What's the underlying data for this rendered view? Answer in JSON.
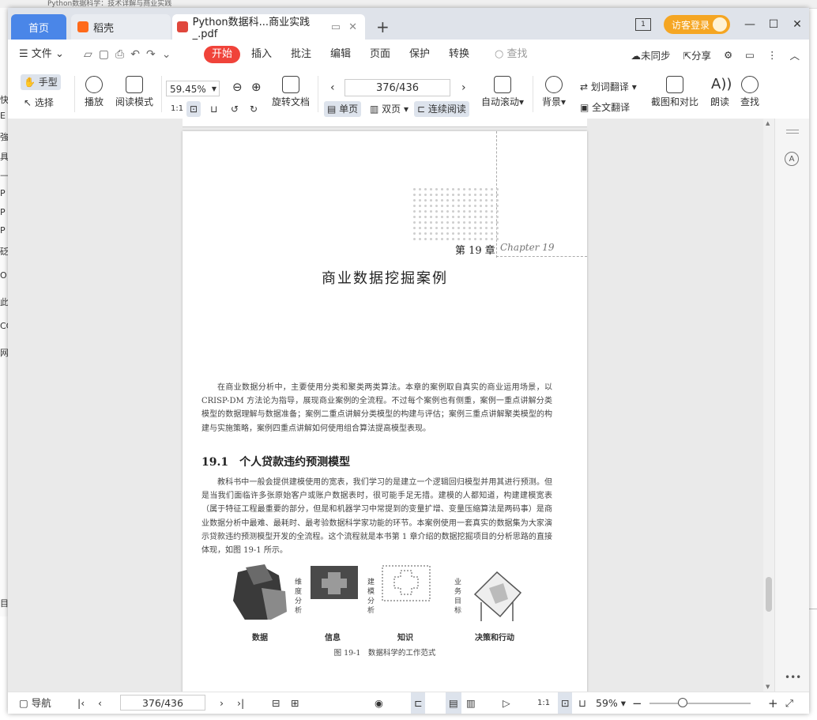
{
  "background_window": {
    "title": "Python数据科学：技术详解与商业实践"
  },
  "tabs": [
    {
      "label": "首页"
    },
    {
      "label": "稻壳"
    },
    {
      "label": "Python数据科...商业实践_.pdf"
    }
  ],
  "titlebar": {
    "guest_label": "访客登录"
  },
  "menu": {
    "file": "文件",
    "items": [
      "开始",
      "插入",
      "批注",
      "编辑",
      "页面",
      "保护",
      "转换"
    ],
    "search": "查找",
    "sync": "未同步",
    "share": "分享"
  },
  "toolbar": {
    "hand": "手型",
    "select": "选择",
    "play": "播放",
    "read_mode": "阅读模式",
    "zoom": "59.45%",
    "actual": "1:1",
    "rotate": "旋转文档",
    "page": "376/436",
    "single": "单页",
    "double": "双页",
    "continuous": "连续阅读",
    "autoscroll": "自动滚动",
    "background": "背景",
    "word_translate": "划词翻译",
    "full_translate": "全文翻译",
    "screenshot_compare": "截图和对比",
    "read_aloud": "朗读",
    "find": "查找"
  },
  "document": {
    "chapter_no": "第 19 章",
    "chapter_en": "Chapter 19",
    "chapter_title": "商业数据挖掘案例",
    "intro": "在商业数据分析中，主要使用分类和聚类两类算法。本章的案例取自真实的商业运用场景，以 CRISP-DM 方法论为指导，展现商业案例的全流程。不过每个案例也有侧重，案例一重点讲解分类模型的数据理解与数据准备；案例二重点讲解分类模型的构建与评估；案例三重点讲解聚类模型的构建与实施策略，案例四重点讲解如何使用组合算法提高模型表现。",
    "section": "19.1　个人贷款违约预测模型",
    "body": "教科书中一般会提供建模使用的宽表，我们学习的是建立一个逻辑回归模型并用其进行预测。但是当我们面临许多张原始客户或账户数据表时，很可能手足无措。建模的人都知道，构建建模宽表（属于特征工程最重要的部分，但是和机器学习中常提到的变量扩增、变量压缩算法是两码事）是商业数据分析中最难、最耗时、最考验数据科学家功能的环节。本案例使用一套真实的数据集为大家演示贷款违约预测模型开发的全流程。这个流程就是本书第 1 章介绍的数据挖掘项目的分析思路的直接体现，如图 19-1 所示。",
    "figure": {
      "labels": [
        "数据",
        "信息",
        "知识",
        "决策和行动"
      ],
      "arrows": [
        "维度分析",
        "建模分析",
        "业务目标"
      ],
      "caption": "图 19-1　数据科学的工作范式"
    }
  },
  "status": {
    "nav": "导航",
    "page": "376/436",
    "actual": "1:1",
    "zoom": "59%"
  }
}
